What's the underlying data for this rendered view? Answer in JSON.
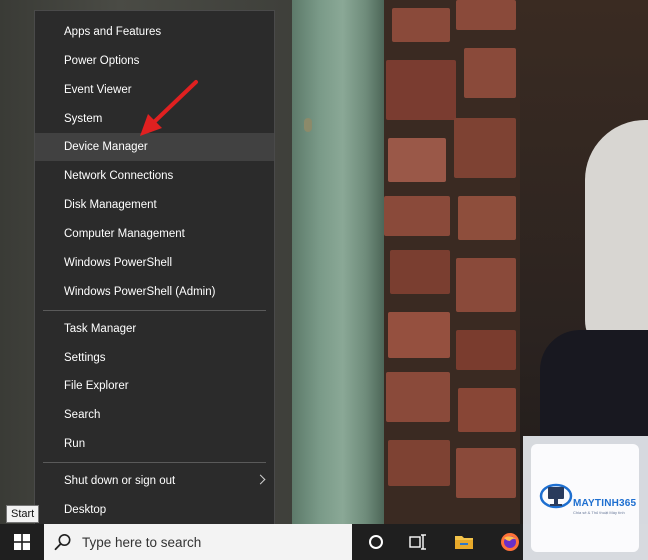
{
  "context_menu": {
    "items": [
      {
        "label": "Apps and Features"
      },
      {
        "label": "Power Options"
      },
      {
        "label": "Event Viewer"
      },
      {
        "label": "System"
      },
      {
        "label": "Device Manager",
        "highlighted": true
      },
      {
        "label": "Network Connections"
      },
      {
        "label": "Disk Management"
      },
      {
        "label": "Computer Management"
      },
      {
        "label": "Windows PowerShell"
      },
      {
        "label": "Windows PowerShell (Admin)"
      },
      {
        "label": "Task Manager"
      },
      {
        "label": "Settings"
      },
      {
        "label": "File Explorer"
      },
      {
        "label": "Search"
      },
      {
        "label": "Run"
      },
      {
        "label": "Shut down or sign out",
        "has_submenu": true
      },
      {
        "label": "Desktop"
      }
    ]
  },
  "taskbar": {
    "search_placeholder": "Type here to search",
    "start_tooltip": "Start",
    "icons": [
      "windows-logo-icon",
      "search-icon",
      "cortana-circle-icon",
      "task-view-icon",
      "file-explorer-icon",
      "firefox-icon"
    ]
  },
  "watermark": {
    "name": "MAYTINH365",
    "tagline": "Chia sẻ & Thủ thuật Máy tính"
  },
  "colors": {
    "menu_bg": "#2b2b2b",
    "menu_highlight": "#414141",
    "arrow": "#e02020",
    "taskbar": "#1f1f1f",
    "accent_blue": "#1e6fd0"
  }
}
